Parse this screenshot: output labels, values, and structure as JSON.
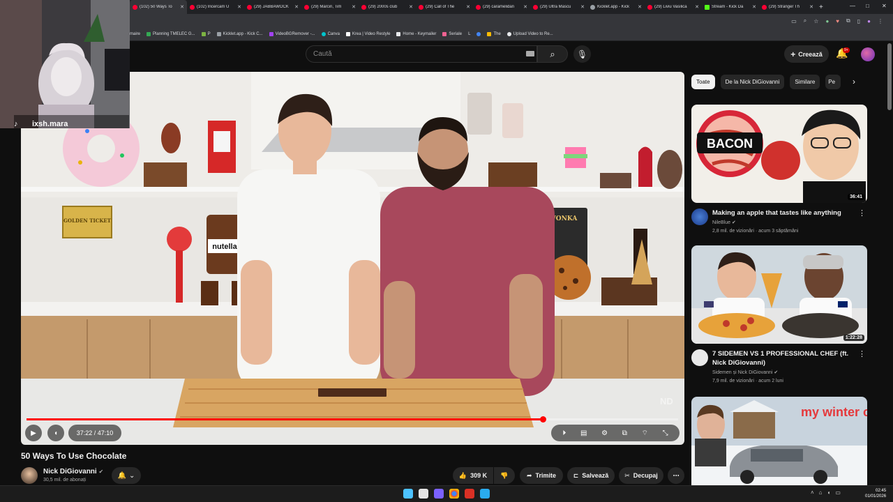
{
  "browser": {
    "tabs": [
      {
        "label": "(102) 50 Ways To",
        "icon": "youtube-icon",
        "active": true
      },
      {
        "label": "(102) Încercăm U",
        "icon": "youtube-icon"
      },
      {
        "label": "(29) JABBAWOCK",
        "icon": "youtube-icon"
      },
      {
        "label": "(29) Marcin, Tim",
        "icon": "youtube-icon"
      },
      {
        "label": "(29) 2000s club",
        "icon": "youtube-icon"
      },
      {
        "label": "(29) Call of The",
        "icon": "youtube-icon"
      },
      {
        "label": "(29) caramelidan",
        "icon": "youtube-icon"
      },
      {
        "label": "(29) Ultra Mascu",
        "icon": "youtube-icon"
      },
      {
        "label": "Kicklet.app - Kick",
        "icon": "globe-icon"
      },
      {
        "label": "(29) Liviu Vasilică",
        "icon": "youtube-icon"
      },
      {
        "label": "Stream - Kick Da",
        "icon": "kick-icon"
      },
      {
        "label": "(29) Stranger Th",
        "icon": "youtube-icon"
      }
    ],
    "bookmarks": [
      "maire",
      "Planning TMELEC G...",
      "P",
      "Kicklet.app - Kick C...",
      "VideoBGRemover -...",
      "Canva",
      "Krea | Video Restyle",
      "Home - Keymailer",
      "Seriale",
      "L",
      "The",
      "Upload Video to Re..."
    ]
  },
  "webcam": {
    "handle": "ixsh.mara",
    "icon": "tiktok-icon"
  },
  "header": {
    "search_placeholder": "Caută",
    "create_label": "Creează",
    "notification_count": "9+"
  },
  "player": {
    "current_time": "37:22",
    "duration": "47:10",
    "time_display": "37:22 / 47:10",
    "progress": 0.792,
    "watermark": "ND",
    "scene_labels": {
      "golden_ticket": "GOLDEN TICKET",
      "nutella": "nutella",
      "wonka": "WONKA"
    }
  },
  "video": {
    "title": "50 Ways To Use Chocolate",
    "channel": "Nick DiGiovanni",
    "subscribers": "30,5 mil. de abonați",
    "likes": "309 K",
    "share_label": "Trimite",
    "save_label": "Salvează",
    "clip_label": "Decupaj"
  },
  "sidebar": {
    "chips": [
      "Toate",
      "De la Nick DiGiovanni",
      "Similare",
      "Pe"
    ],
    "recommendations": [
      {
        "title": "Making an apple that tastes like anything",
        "channel": "NileBlue",
        "meta": "2,8 mil. de vizionări · acum 3 săptămâni",
        "duration": "36:41",
        "thumb_text": "BACON"
      },
      {
        "title": "7 SIDEMEN VS 1 PROFESSIONAL CHEF (ft. Nick DiGiovanni)",
        "channel": "Sidemen și Nick DiGiovanni",
        "meta": "7,9 mil. de vizionări · acum 2 luni",
        "duration": "1:22:28",
        "thumb_text": ""
      },
      {
        "title": "",
        "channel": "",
        "meta": "",
        "duration": "",
        "thumb_text": "my winter car"
      }
    ]
  },
  "taskbar": {
    "time": "02:45",
    "date": "01/01/2026"
  },
  "colors": {
    "accent": "#ff0000",
    "background": "#0f0f0f",
    "chip": "#272727"
  }
}
